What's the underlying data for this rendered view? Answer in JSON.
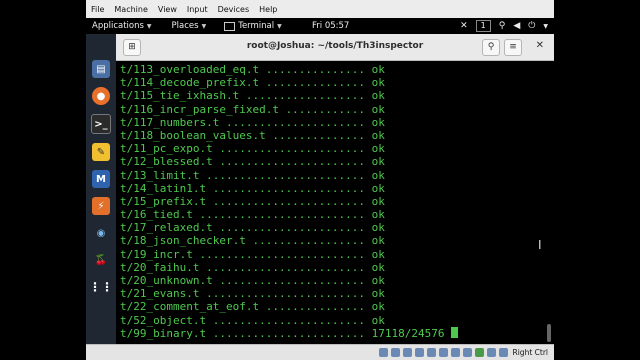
{
  "vbox_menu": [
    "File",
    "Machine",
    "View",
    "Input",
    "Devices",
    "Help"
  ],
  "topbar": {
    "applications": "Applications",
    "places": "Places",
    "terminal": "Terminal",
    "clock": "Fri 05:57",
    "workspace": "1"
  },
  "window": {
    "title": "root@Joshua: ~/tools/Th3inspector"
  },
  "terminal_lines": [
    "t/113_overloaded_eq.t ............... ok",
    "t/114_decode_prefix.t ............... ok",
    "t/115_tie_ixhash.t .................. ok",
    "t/116_incr_parse_fixed.t ............ ok",
    "t/117_numbers.t ..................... ok",
    "t/118_boolean_values.t .............. ok",
    "t/11_pc_expo.t ...................... ok",
    "t/12_blessed.t ...................... ok",
    "t/13_limit.t ........................ ok",
    "t/14_latin1.t ....................... ok",
    "t/15_prefix.t ....................... ok",
    "t/16_tied.t ......................... ok",
    "t/17_relaxed.t ...................... ok",
    "t/18_json_checker.t ................. ok",
    "t/19_incr.t ......................... ok",
    "t/20_faihu.t ........................ ok",
    "t/20_unknown.t ...................... ok",
    "t/21_evans.t ........................ ok",
    "t/22_comment_at_eof.t ............... ok",
    "t/52_object.t ....................... ok"
  ],
  "terminal_last": "t/99_binary.t ....................... 17118/24576 ",
  "statusbar": {
    "host_key": "Right Ctrl"
  },
  "dock_icons": [
    "files-icon",
    "firefox-icon",
    "terminal-icon",
    "text-editor-icon",
    "metasploit-icon",
    "burpsuite-icon",
    "eye-icon",
    "cherry-icon",
    "app-grid-icon"
  ],
  "colors": {
    "terminal_text": "#4ec94e",
    "terminal_bg": "#000000",
    "dock_bg": "#1f2733"
  }
}
